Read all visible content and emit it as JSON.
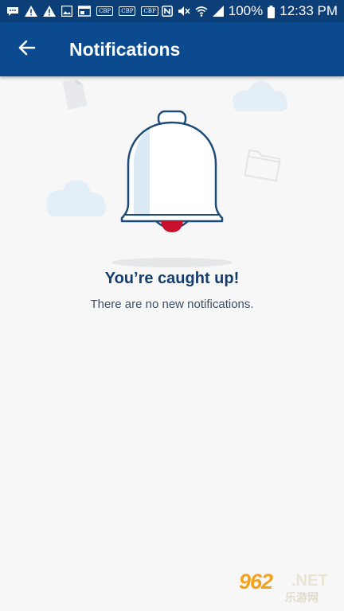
{
  "status_bar": {
    "cbp_labels": [
      "CBP",
      "CBP",
      "CBP"
    ],
    "nfc_label": "N",
    "battery_percent": "100%",
    "time": "12:33 PM",
    "icons": [
      "chat-icon",
      "warning-icon",
      "warning-icon",
      "image-icon",
      "window-icon",
      "nfc-icon",
      "mute-icon",
      "wifi-icon",
      "signal-icon",
      "battery-icon"
    ]
  },
  "toolbar": {
    "back_icon": "arrow-left-icon",
    "title": "Notifications"
  },
  "empty_state": {
    "icon": "bell-icon",
    "title": "You’re caught up!",
    "subtitle": "There are no new notifications."
  },
  "watermark": {
    "number": "962",
    "suffix": ".NET",
    "chinese": "乐游网"
  },
  "colors": {
    "status_bar": "#0c3f78",
    "toolbar": "#0c4a8f",
    "background": "#f7f7f8",
    "title_text": "#153e6e",
    "bell_outline": "#1f4b78",
    "bell_clapper": "#c8102e"
  }
}
